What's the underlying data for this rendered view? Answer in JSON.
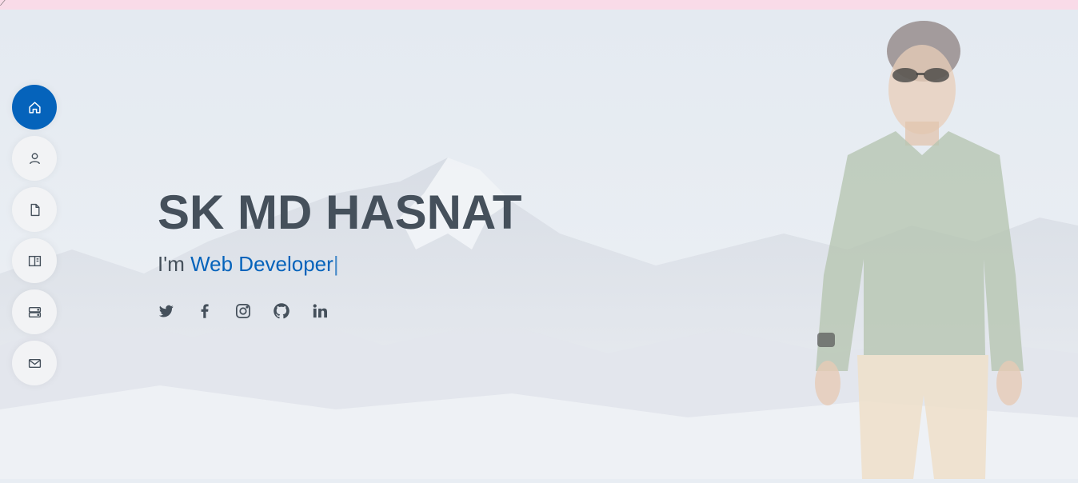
{
  "hero": {
    "name": "SK MD HASNAT",
    "prefix": "I'm ",
    "typed": "Web Developer",
    "cursor": "|"
  },
  "nav": {
    "items": [
      {
        "name": "home",
        "icon": "home-icon",
        "active": true
      },
      {
        "name": "about",
        "icon": "person-icon",
        "active": false
      },
      {
        "name": "resume",
        "icon": "file-icon",
        "active": false
      },
      {
        "name": "portfolio",
        "icon": "book-half-icon",
        "active": false
      },
      {
        "name": "services",
        "icon": "server-icon",
        "active": false
      },
      {
        "name": "contact",
        "icon": "envelope-icon",
        "active": false
      }
    ]
  },
  "social": [
    "twitter-icon",
    "facebook-icon",
    "instagram-icon",
    "github-icon",
    "linkedin-icon"
  ],
  "colors": {
    "accent": "#0563bb",
    "text": "#45505b",
    "topbar": "#f9dbe8",
    "nav_bg": "#f2f3f5"
  }
}
